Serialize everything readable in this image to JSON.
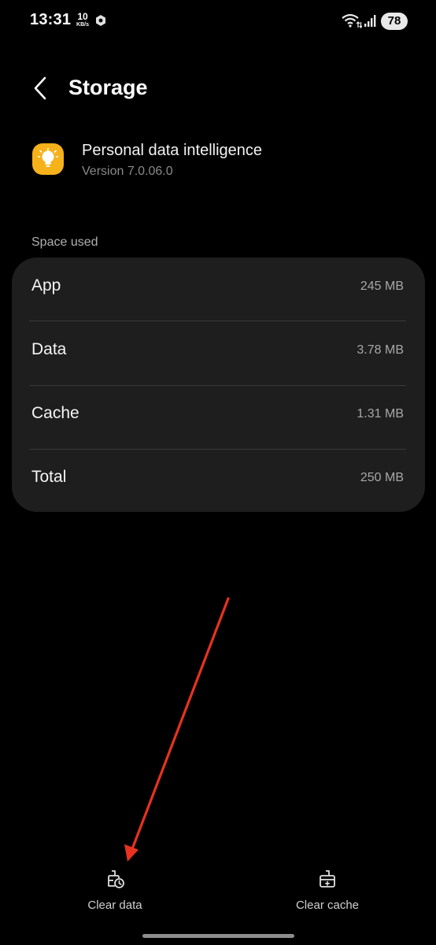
{
  "status_bar": {
    "time": "13:31",
    "net_speed_value": "10",
    "net_speed_unit": "KB/s",
    "battery": "78"
  },
  "header": {
    "title": "Storage"
  },
  "app": {
    "name": "Personal data intelligence",
    "version": "Version 7.0.06.0",
    "icon": "lightbulb-icon",
    "icon_color": "#f6b21b"
  },
  "space_used": {
    "label": "Space used",
    "rows": [
      {
        "label": "App",
        "value": "245 MB"
      },
      {
        "label": "Data",
        "value": "3.78 MB"
      },
      {
        "label": "Cache",
        "value": "1.31 MB"
      },
      {
        "label": "Total",
        "value": "250 MB"
      }
    ]
  },
  "actions": {
    "clear_data": "Clear data",
    "clear_cache": "Clear cache"
  },
  "annotation": {
    "arrow_color": "#e8321f"
  }
}
